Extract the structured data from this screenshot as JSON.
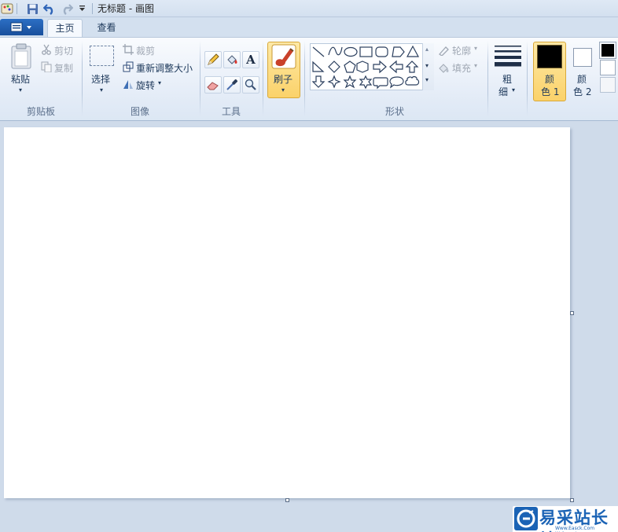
{
  "window": {
    "title": "无标题 - 画图"
  },
  "quick_access": {
    "icons": [
      "app-icon",
      "save-icon",
      "undo-icon",
      "redo-icon",
      "customize-icon"
    ]
  },
  "tabs": [
    {
      "label": "主页",
      "active": true
    },
    {
      "label": "查看",
      "active": false
    }
  ],
  "clipboard": {
    "paste_label": "粘贴",
    "cut_label": "剪切",
    "copy_label": "复制",
    "group_label": "剪贴板"
  },
  "image": {
    "select_label": "选择",
    "crop_label": "裁剪",
    "resize_label": "重新调整大小",
    "rotate_label": "旋转",
    "group_label": "图像"
  },
  "tools": {
    "group_label": "工具"
  },
  "brushes": {
    "label": "刷子"
  },
  "shapes": {
    "outline_label": "轮廓",
    "fill_label": "填充",
    "group_label": "形状"
  },
  "size": {
    "label_line1": "粗",
    "label_line2": "细"
  },
  "colors": {
    "color1_line1": "颜",
    "color1_line2": "色 1",
    "color2_line1": "颜",
    "color2_line2": "色 2",
    "color1_value": "#000000",
    "color2_value": "#ffffff",
    "palette": [
      "#000000",
      "#ffffff",
      "#ffffff"
    ],
    "accent_selected": "#fbd26a"
  },
  "watermark": {
    "text": "易采站长站",
    "url": "Www.Easck.Com Webmaster"
  }
}
